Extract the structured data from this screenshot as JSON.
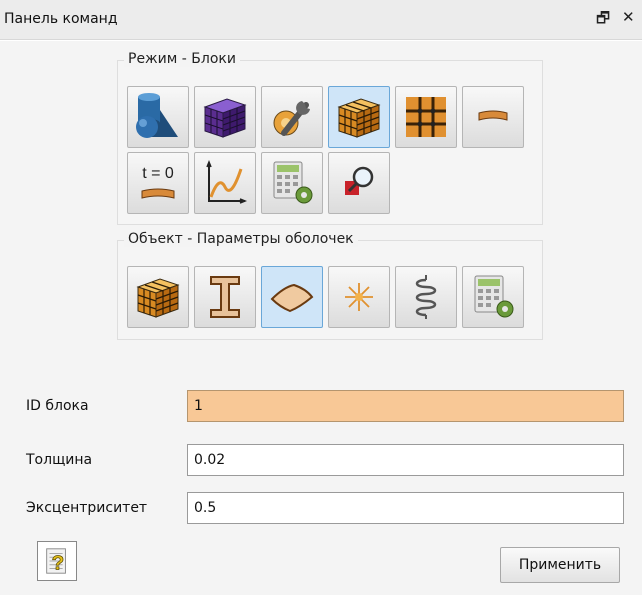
{
  "window": {
    "title": "Панель команд",
    "float_glyph": "🗗",
    "close_glyph": "✕"
  },
  "mode_group": {
    "legend": "Режим - Блоки",
    "buttons": [
      {
        "icon": "geometry-icon",
        "active": false
      },
      {
        "icon": "mesh-cube-icon",
        "active": false
      },
      {
        "icon": "tools-wrench-icon",
        "active": false
      },
      {
        "icon": "block-cube-icon",
        "active": true
      },
      {
        "icon": "grid-icon",
        "active": false
      },
      {
        "icon": "shell-plate-icon",
        "active": false
      },
      {
        "icon": "initial-condition-icon",
        "active": false,
        "text": "t = 0"
      },
      {
        "icon": "curve-chart-icon",
        "active": false
      },
      {
        "icon": "calculator-settings-icon",
        "active": false
      },
      {
        "icon": "zoom-inspect-icon",
        "active": false
      }
    ]
  },
  "object_group": {
    "legend": "Объект - Параметры оболочек",
    "buttons": [
      {
        "icon": "block-cube-icon",
        "active": false
      },
      {
        "icon": "i-beam-icon",
        "active": false
      },
      {
        "icon": "shell-surface-icon",
        "active": true
      },
      {
        "icon": "point-star-icon",
        "active": false
      },
      {
        "icon": "spring-icon",
        "active": false
      },
      {
        "icon": "calculator-settings-icon",
        "active": false
      }
    ]
  },
  "form": {
    "block_id_label": "ID блока",
    "block_id_value": "1",
    "thickness_label": "Толщина",
    "thickness_value": "0.02",
    "eccentricity_label": "Эксцентриситет",
    "eccentricity_value": "0.5"
  },
  "footer": {
    "help_glyph": "?",
    "apply_label": "Применить"
  },
  "colors": {
    "highlight_field": "#f8c896",
    "active_button": "#cfe5f8",
    "block_orange": "#e8a23a"
  }
}
